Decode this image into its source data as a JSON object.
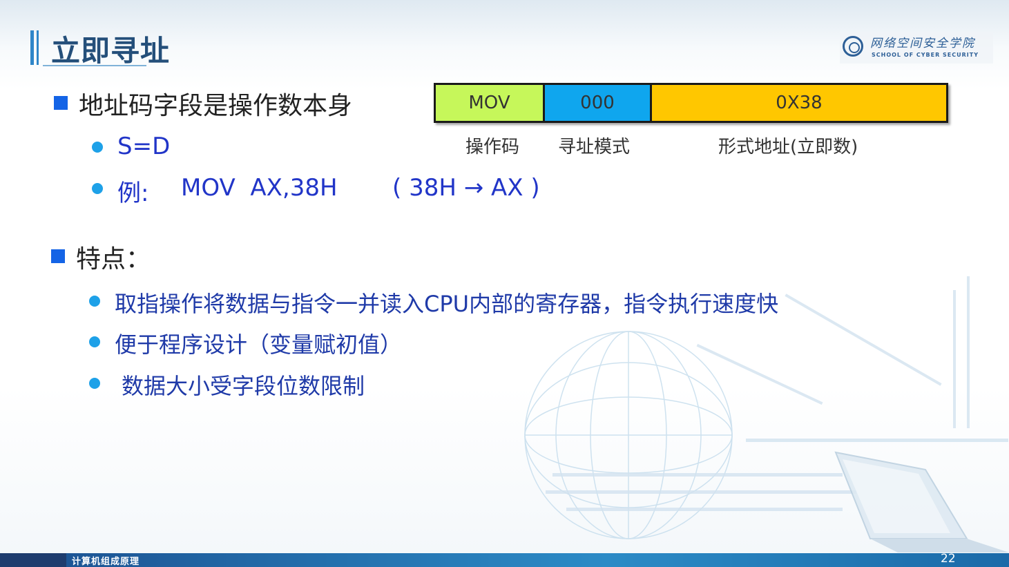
{
  "title": "立即寻址",
  "logo": {
    "name_cn": "网络空间安全学院",
    "name_en": "SCHOOL OF CYBER SECURITY"
  },
  "section1": {
    "heading": "地址码字段是操作数本身",
    "points": [
      {
        "text": "S=D"
      },
      {
        "label": "例:",
        "instr": "MOV  AX,38H",
        "note": "( 38H → AX )"
      }
    ]
  },
  "format": {
    "fields": [
      {
        "value": "MOV",
        "label": "操作码",
        "color": "#c6f75a"
      },
      {
        "value": "000",
        "label": "寻址模式",
        "color": "#0fa6ee"
      },
      {
        "value": "0X38",
        "label": "形式地址(立即数)",
        "color": "#ffc700"
      }
    ]
  },
  "section2": {
    "heading": "特点：",
    "points": [
      "取指操作将数据与指令一并读入CPU内部的寄存器，指令执行速度快",
      "便于程序设计（变量赋初值）",
      "数据大小受字段位数限制"
    ]
  },
  "footer": {
    "course": "计算机组成原理",
    "page": "22"
  },
  "colors": {
    "title": "#244f7a",
    "square_bullet": "#1464e6",
    "round_bullet": "#1ea1e8",
    "point_text": "#1f3aa8",
    "footer": "#2c8bc6"
  }
}
